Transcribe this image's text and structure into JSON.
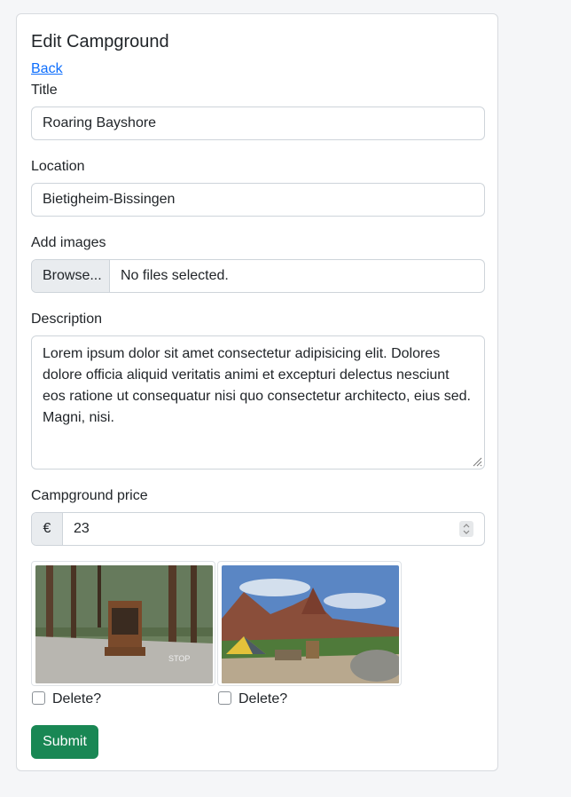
{
  "page": {
    "heading": "Edit Campground",
    "back_link": "Back"
  },
  "form": {
    "title_label": "Title",
    "title_value": "Roaring Bayshore",
    "location_label": "Location",
    "location_value": "Bietigheim-Bissingen",
    "images_label": "Add images",
    "browse_label": "Browse...",
    "no_files_text": "No files selected.",
    "description_label": "Description",
    "description_value": "Lorem ipsum dolor sit amet consectetur adipisicing elit. Dolores dolore officia aliquid veritatis animi et excepturi delectus nesciunt eos ratione ut consequatur nisi quo consectetur architecto, eius sed. Magni, nisi.",
    "price_label": "Campground price",
    "currency_symbol": "€",
    "price_value": "23",
    "images": [
      {
        "delete_label": "Delete?",
        "checked": false
      },
      {
        "delete_label": "Delete?",
        "checked": false
      }
    ],
    "submit_label": "Submit"
  },
  "colors": {
    "link": "#0d6efd",
    "submit": "#198754",
    "border": "#ced4da",
    "addon_bg": "#e9ecef"
  }
}
